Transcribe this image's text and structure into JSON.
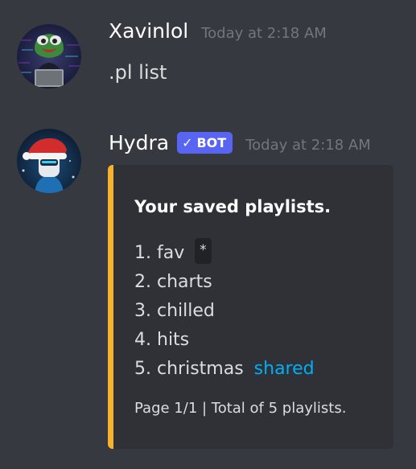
{
  "messages": [
    {
      "username": "Xavinlol",
      "timestamp": "Today at 2:18 AM",
      "content": ".pl list",
      "avatar_icon": "pepe-hacker-avatar"
    },
    {
      "username": "Hydra",
      "badge": "BOT",
      "timestamp": "Today at 2:18 AM",
      "avatar_icon": "robot-santa-hat-avatar",
      "embed": {
        "accent_color": "#f7b22d",
        "title": "Your saved playlists.",
        "items": [
          {
            "number": "1.",
            "name": "fav",
            "tag": "*"
          },
          {
            "number": "2.",
            "name": "charts"
          },
          {
            "number": "3.",
            "name": "chilled"
          },
          {
            "number": "4.",
            "name": "hits"
          },
          {
            "number": "5.",
            "name": "christmas",
            "link": "shared"
          }
        ],
        "footer": "Page 1/1 | Total of 5 playlists."
      }
    }
  ],
  "colors": {
    "background": "#36393f",
    "embed_background": "#2f3136",
    "bot_badge": "#5865f2",
    "link": "#00aff4",
    "timestamp": "#72767d"
  }
}
